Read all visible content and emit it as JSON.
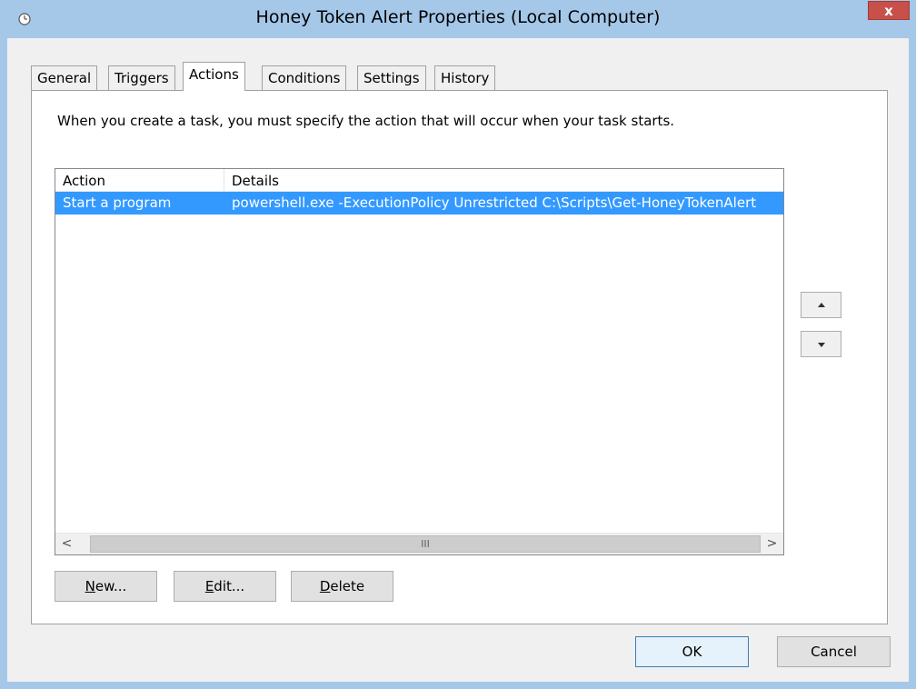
{
  "window": {
    "title": "Honey Token Alert Properties (Local Computer)",
    "close_label": "x"
  },
  "tabs": [
    {
      "label": "General"
    },
    {
      "label": "Triggers"
    },
    {
      "label": "Actions",
      "active": true
    },
    {
      "label": "Conditions"
    },
    {
      "label": "Settings"
    },
    {
      "label": "History"
    }
  ],
  "actions_tab": {
    "description": "When you create a task, you must specify the action that will occur when your task starts.",
    "columns": [
      "Action",
      "Details"
    ],
    "rows": [
      {
        "action": "Start a program",
        "details": "powershell.exe -ExecutionPolicy Unrestricted C:\\Scripts\\Get-HoneyTokenAlert"
      }
    ],
    "scroll_left": "<",
    "scroll_right": ">",
    "scroll_grip": "III",
    "move_up_icon": "triangle-up",
    "move_down_icon": "triangle-down",
    "buttons": {
      "new": {
        "mnemonic": "N",
        "rest": "ew..."
      },
      "edit": {
        "mnemonic": "E",
        "rest": "dit..."
      },
      "delete": {
        "mnemonic": "D",
        "rest": "elete"
      }
    }
  },
  "footer": {
    "ok": "OK",
    "cancel": "Cancel"
  },
  "colors": {
    "frame": "#a5c8e9",
    "close": "#c7504b",
    "selection": "#3399ff"
  }
}
